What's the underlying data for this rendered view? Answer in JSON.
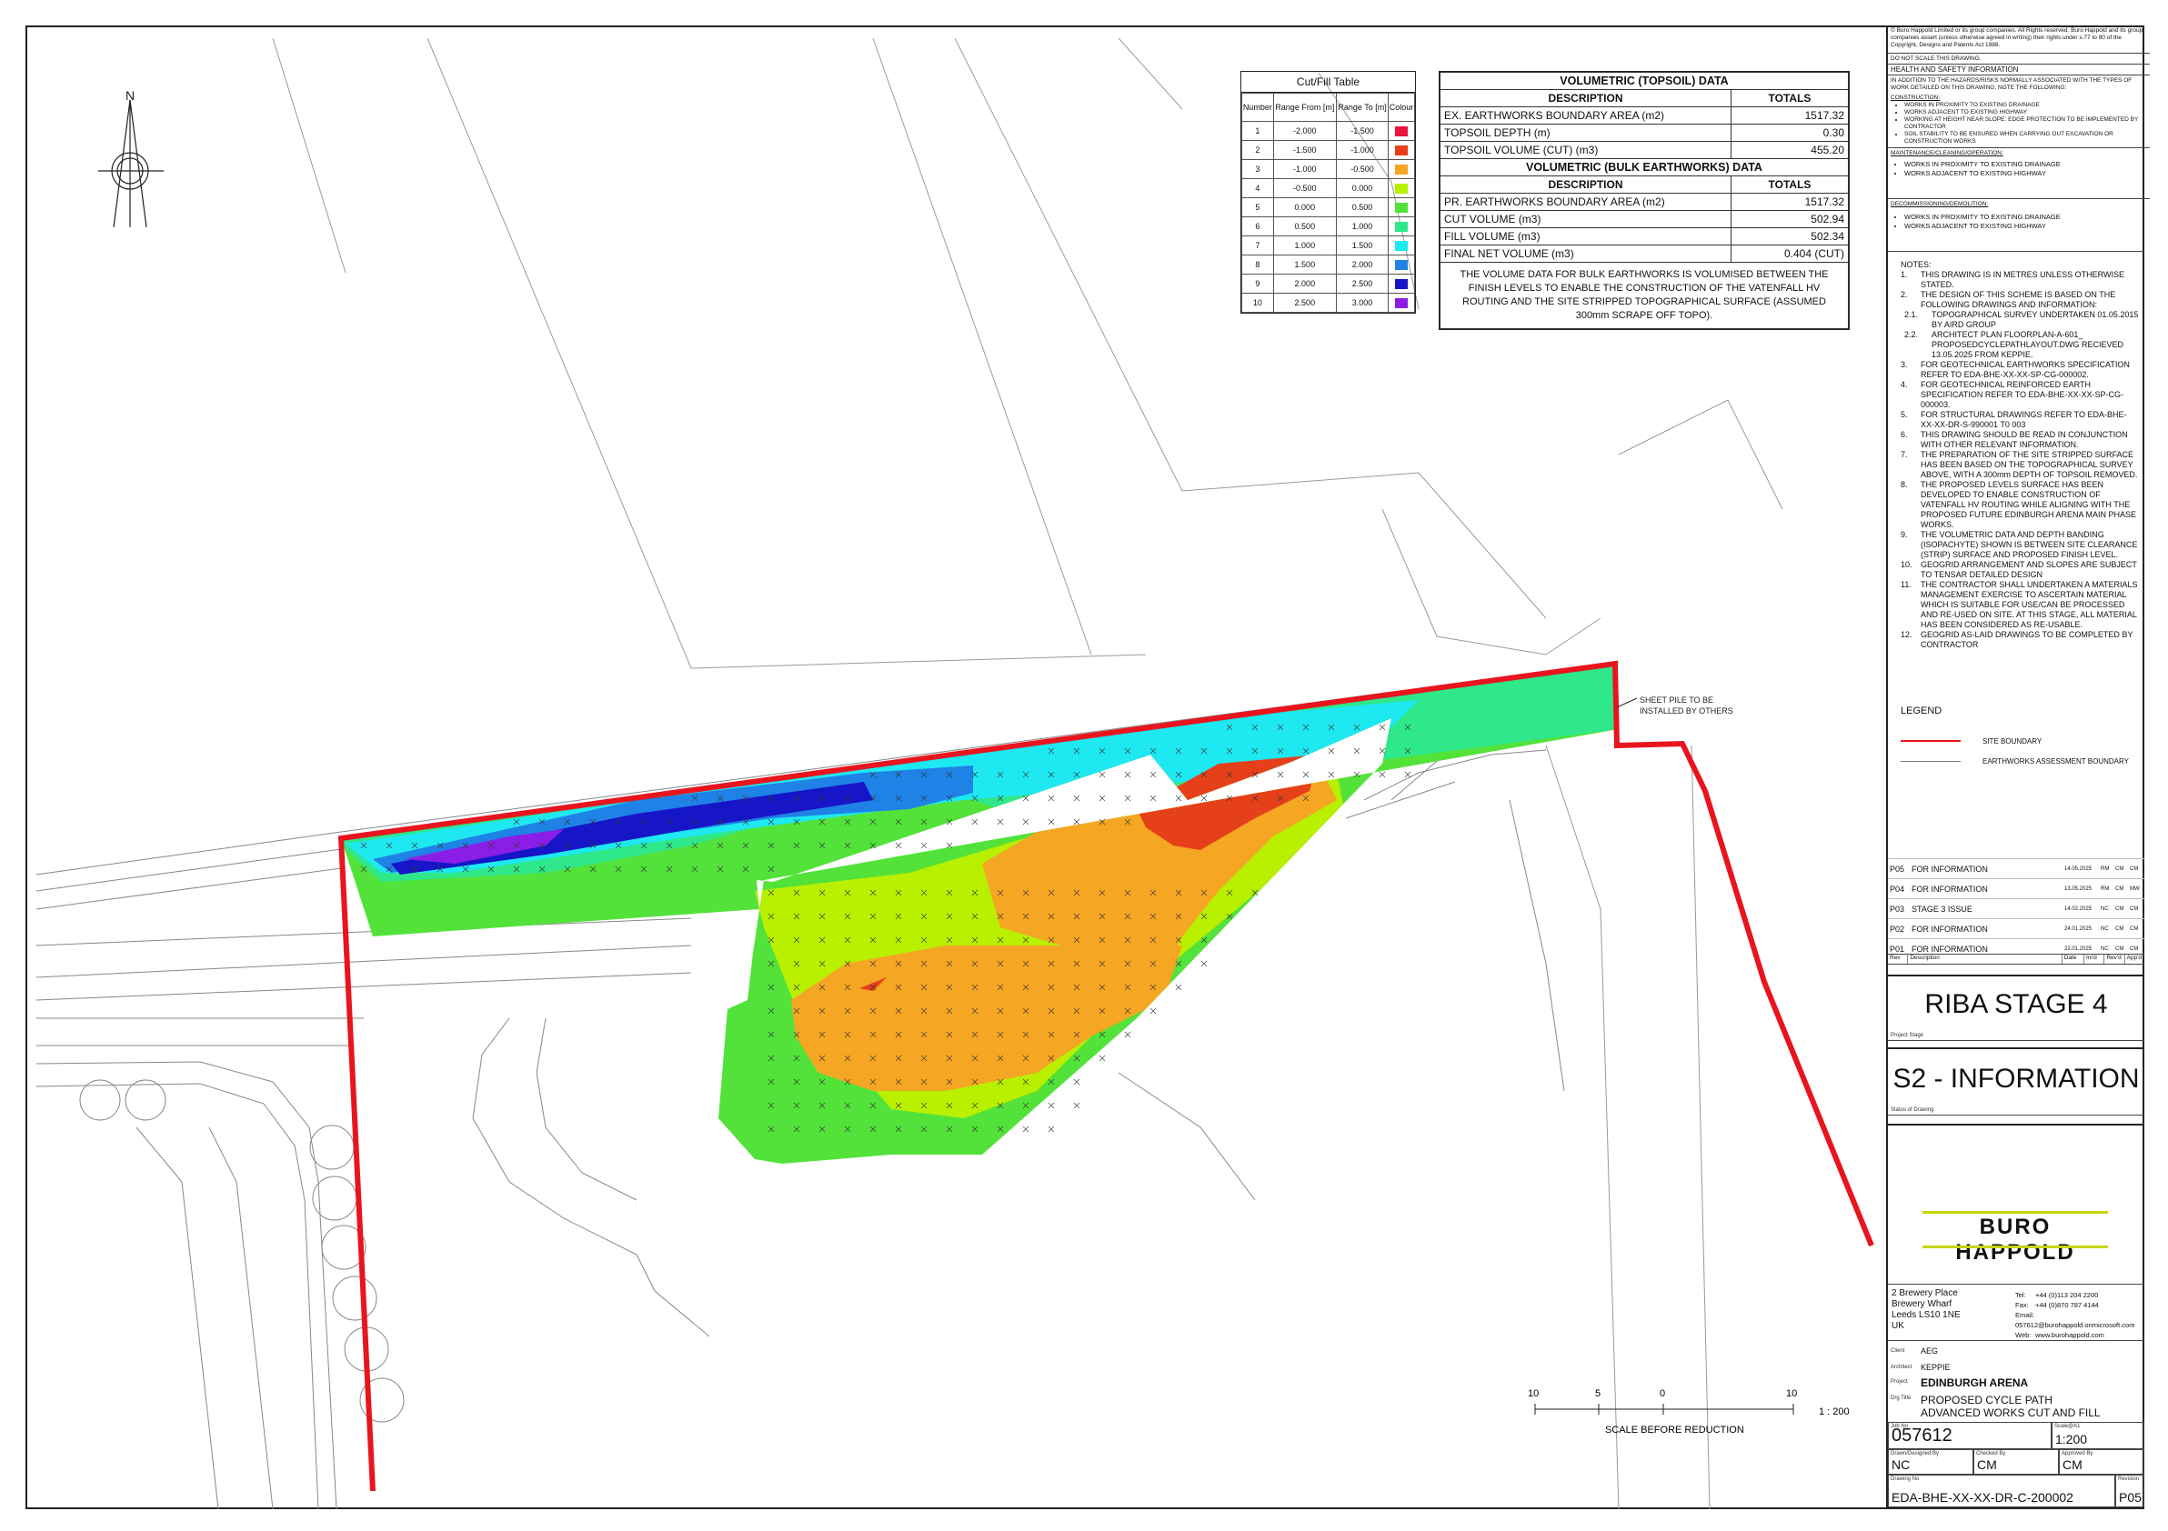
{
  "north_label": "N",
  "cut_fill_table": {
    "title": "Cut/Fill Table",
    "headers": [
      "Number",
      "Range From [m]",
      "Range To [m]",
      "Colour"
    ],
    "rows": [
      {
        "number": "1",
        "from": "-2.000",
        "to": "-1.500",
        "color": "#e8143c"
      },
      {
        "number": "2",
        "from": "-1.500",
        "to": "-1.000",
        "color": "#e6401a"
      },
      {
        "number": "3",
        "from": "-1.000",
        "to": "-0.500",
        "color": "#f5a623"
      },
      {
        "number": "4",
        "from": "-0.500",
        "to": "0.000",
        "color": "#b8f000"
      },
      {
        "number": "5",
        "from": "0.000",
        "to": "0.500",
        "color": "#52e23a"
      },
      {
        "number": "6",
        "from": "0.500",
        "to": "1.000",
        "color": "#2ee88a"
      },
      {
        "number": "7",
        "from": "1.000",
        "to": "1.500",
        "color": "#1ee8f0"
      },
      {
        "number": "8",
        "from": "1.500",
        "to": "2.000",
        "color": "#1e82e6"
      },
      {
        "number": "9",
        "from": "2.000",
        "to": "2.500",
        "color": "#1616c8"
      },
      {
        "number": "10",
        "from": "2.500",
        "to": "3.000",
        "color": "#8a1ee6"
      }
    ]
  },
  "volumetric": {
    "topsoil_title": "VOLUMETRIC (TOPSOIL) DATA",
    "col_description": "DESCRIPTION",
    "col_totals": "TOTALS",
    "topsoil_rows": [
      {
        "label": "EX. EARTHWORKS BOUNDARY AREA (m2)",
        "value": "1517.32"
      },
      {
        "label": "TOPSOIL DEPTH (m)",
        "value": "0.30"
      },
      {
        "label": "TOPSOIL VOLUME (CUT) (m3)",
        "value": "455.20"
      }
    ],
    "bulk_title": "VOLUMETRIC (BULK EARTHWORKS) DATA",
    "bulk_rows": [
      {
        "label": "PR. EARTHWORKS BOUNDARY AREA (m2)",
        "value": "1517.32"
      },
      {
        "label": "CUT VOLUME (m3)",
        "value": "502.94"
      },
      {
        "label": "FILL VOLUME (m3)",
        "value": "502.34"
      },
      {
        "label": "FINAL NET VOLUME (m3)",
        "value": "0.404 (CUT)"
      }
    ],
    "note": "THE VOLUME DATA FOR BULK EARTHWORKS IS VOLUMISED BETWEEN THE FINISH LEVELS TO ENABLE THE CONSTRUCTION OF THE VATENFALL HV ROUTING AND THE SITE STRIPPED TOPOGRAPHICAL SURFACE (ASSUMED 300mm SCRAPE OFF TOPO)."
  },
  "sheet_pile_note": "SHEET PILE TO BE INSTALLED BY OTHERS",
  "scale_bar": {
    "labels": [
      "10",
      "5",
      "0",
      "10"
    ],
    "ratio": "1 : 200",
    "caption": "SCALE BEFORE REDUCTION"
  },
  "title_block": {
    "copyright": "© Buro Happold Limited or its group companies. All Rights reserved. Buro Happold and its group companies assert (unless otherwise agreed in writing) their rights under s.77 to 80 of the Copyright, Designs and Patents Act 1988.",
    "do_not_scale": "DO NOT SCALE THIS DRAWING.",
    "hs_title": "HEALTH AND SAFETY INFORMATION",
    "hs_intro": "IN ADDITION TO THE HAZARDS/RISKS NORMALLY ASSOCIATED WITH THE TYPES OF WORK DETAILED ON THIS DRAWING, NOTE THE FOLLOWING:",
    "construction_title": "CONSTRUCTION:",
    "construction_items": [
      "WORKS IN PROXIMITY TO EXISTING DRAINAGE",
      "WORKS ADJACENT TO EXISTING HIGHWAY",
      "WORKING AT HEIGHT NEAR SLOPE: EDGE PROTECTION TO BE IMPLEMENTED BY CONTRACTOR",
      "SOIL STABILITY TO BE ENSURED WHEN CARRYING OUT EXCAVATION OR CONSTRUCTION WORKS"
    ],
    "maintenance_title": "MAINTENANCE/CLEANING/OPERATION:",
    "maintenance_items": [
      "WORKS IN PROXIMITY TO EXISTING DRAINAGE",
      "WORKS ADJACENT TO EXISTING HIGHWAY"
    ],
    "decom_title": "DECOMMISSIONING/DEMOLITION:",
    "decom_items": [
      "WORKS IN PROXIMITY TO EXISTING DRAINAGE",
      "WORKS ADJACENT TO EXISTING HIGHWAY"
    ],
    "notes_title": "NOTES:",
    "notes": [
      {
        "n": "1.",
        "t": "THIS DRAWING IS IN METRES UNLESS OTHERWISE STATED."
      },
      {
        "n": "2.",
        "t": "THE DESIGN OF THIS SCHEME IS BASED ON THE FOLLOWING DRAWINGS AND INFORMATION:"
      },
      {
        "n": "2.1.",
        "t": "TOPOGRAPHICAL SURVEY UNDERTAKEN 01.05.2015 BY AIRD GROUP"
      },
      {
        "n": "2.2.",
        "t": "ARCHITECT PLAN FLOORPLAN-A-601_ PROPOSEDCYCLEPATHLAYOUT.DWG RECIEVED 13.05.2025 FROM KEPPIE."
      },
      {
        "n": "3.",
        "t": "FOR GEOTECHNICAL EARTHWORKS SPECIFICATION REFER TO EDA-BHE-XX-XX-SP-CG-000002."
      },
      {
        "n": "4.",
        "t": "FOR GEOTECHNICAL REINFORCED EARTH SPECIFICATION REFER TO EDA-BHE-XX-XX-SP-CG-000003."
      },
      {
        "n": "5.",
        "t": "FOR STRUCTURAL DRAWINGS REFER TO EDA-BHE-XX-XX-DR-S-990001 T0 003"
      },
      {
        "n": "6.",
        "t": "THIS DRAWING SHOULD BE READ IN CONJUNCTION WITH OTHER RELEVANT INFORMATION."
      },
      {
        "n": "7.",
        "t": "THE PREPARATION OF THE SITE STRIPPED SURFACE HAS BEEN BASED ON THE TOPOGRAPHICAL SURVEY ABOVE, WITH A 300mm DEPTH OF TOPSOIL REMOVED."
      },
      {
        "n": "8.",
        "t": "THE PROPOSED LEVELS SURFACE HAS BEEN DEVELOPED TO ENABLE CONSTRUCTION OF VATENFALL HV ROUTING WHILE ALIGNING WITH THE PROPOSED FUTURE EDINBURGH ARENA MAIN PHASE WORKS."
      },
      {
        "n": "9.",
        "t": "THE VOLUMETRIC DATA AND DEPTH BANDING (ISOPACHYTE) SHOWN IS BETWEEN SITE CLEARANCE (STRIP) SURFACE AND PROPOSED FINISH LEVEL."
      },
      {
        "n": "10.",
        "t": "GEOGRID ARRANGEMENT AND SLOPES ARE SUBJECT TO TENSAR DETAILED DESIGN"
      },
      {
        "n": "11.",
        "t": "THE CONTRACTOR SHALL UNDERTAKEN A MATERIALS MANAGEMENT EXERCISE TO ASCERTAIN MATERIAL WHICH IS SUITABLE FOR USE/CAN BE PROCESSED AND RE-USED ON SITE. AT THIS STAGE, ALL MATERIAL HAS BEEN CONSIDERED AS RE-USABLE."
      },
      {
        "n": "12.",
        "t": "GEOGRID AS-LAID DRAWINGS TO BE COMPLETED BY CONTRACTOR"
      }
    ],
    "legend_title": "LEGEND",
    "legend_items": [
      {
        "label": "SITE BOUNDARY",
        "color": "#e8141e"
      },
      {
        "label": "EARTHWORKS ASSESSMENT BOUNDARY",
        "color": "#777777"
      }
    ],
    "revisions": [
      {
        "rev": "P05",
        "desc": "FOR INFORMATION",
        "date": "14.05.2025",
        "a": "RM",
        "b": "CM",
        "c": "CM"
      },
      {
        "rev": "P04",
        "desc": "FOR INFORMATION",
        "date": "13.05.2025",
        "a": "RM",
        "b": "CM",
        "c": "MW"
      },
      {
        "rev": "P03",
        "desc": "STAGE 3 ISSUE",
        "date": "14.02.2025",
        "a": "NC",
        "b": "CM",
        "c": "CM"
      },
      {
        "rev": "P02",
        "desc": "FOR INFORMATION",
        "date": "24.01.2025",
        "a": "NC",
        "b": "CM",
        "c": "CM"
      },
      {
        "rev": "P01",
        "desc": "FOR INFORMATION",
        "date": "22.01.2025",
        "a": "NC",
        "b": "CM",
        "c": "CM"
      }
    ],
    "rev_headers": [
      "Rev",
      "Description",
      "Date",
      "Ini'd",
      "Rev'd",
      "App'd"
    ],
    "project_stage": "RIBA STAGE 4",
    "project_stage_label": "Project Stage",
    "status": "S2 - INFORMATION",
    "status_label": "Status of Drawing",
    "logo": "BURO HAPPOLD",
    "address": [
      "2 Brewery Place",
      "Brewery Wharf",
      "Leeds LS10 1NE",
      "UK"
    ],
    "contact": [
      {
        "k": "Tel:",
        "v": "+44 (0)113 204 2200"
      },
      {
        "k": "Fax:",
        "v": "+44 (0)870 787 4144"
      },
      {
        "k": "Email:",
        "v": "057612@burohappold.onmicrosoft.com"
      },
      {
        "k": "Web:",
        "v": "www.burohappold.com"
      }
    ],
    "client_label": "Client",
    "client": "AEG",
    "architect_label": "Architect",
    "architect": "KEPPIE",
    "project_label": "Project",
    "project": "EDINBURGH ARENA",
    "title_label": "Drg Title",
    "title_lines": [
      "PROPOSED CYCLE PATH",
      "ADVANCED WORKS CUT AND FILL"
    ],
    "job_no_label": "Job No",
    "job_no": "057612",
    "scale_label": "Scale@A1",
    "scale": "1:200",
    "drawn_label": "Drawn/Designed By",
    "drawn": "NC",
    "checked_label": "Checked By",
    "checked": "CM",
    "approved_label": "Approved By",
    "approved": "CM",
    "drawing_no_label": "Drawing No",
    "drawing_no": "EDA-BHE-XX-XX-DR-C-200002",
    "revision_label": "Revision",
    "revision": "P05"
  }
}
